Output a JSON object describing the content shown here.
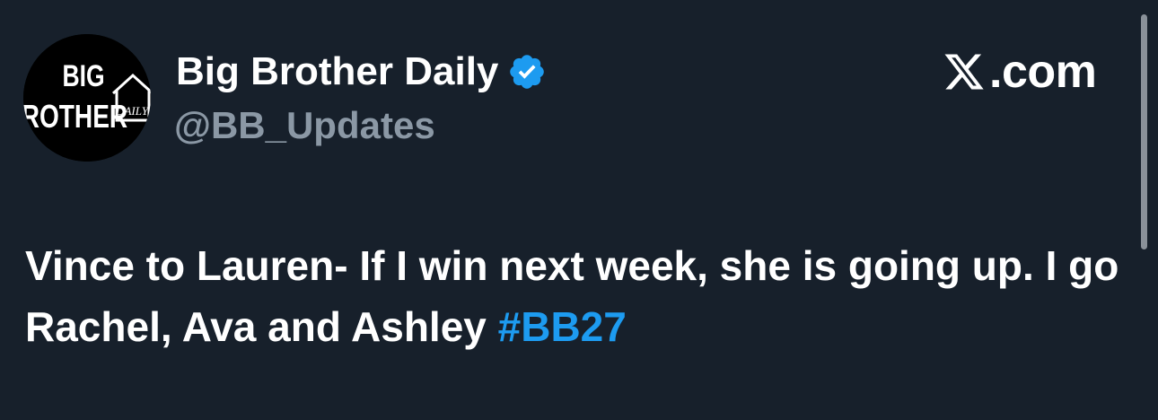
{
  "tweet": {
    "display_name": "Big Brother Daily",
    "handle": "@BB_Updates",
    "verified": true,
    "text": "Vince to Lauren- If I win next week, she is going up. I go Rachel, Ava and Ashley ",
    "hashtag": "#BB27"
  },
  "brand": {
    "domain": ".com",
    "logo_icon": "x-logo-icon"
  },
  "avatar": {
    "line1": "BIG",
    "line2": "BROTHER",
    "tag": "DAILY"
  },
  "colors": {
    "background": "#17202b",
    "text": "#ffffff",
    "handle": "#8b98a5",
    "hashtag": "#1d9bf0",
    "verified": "#1d9bf0"
  }
}
